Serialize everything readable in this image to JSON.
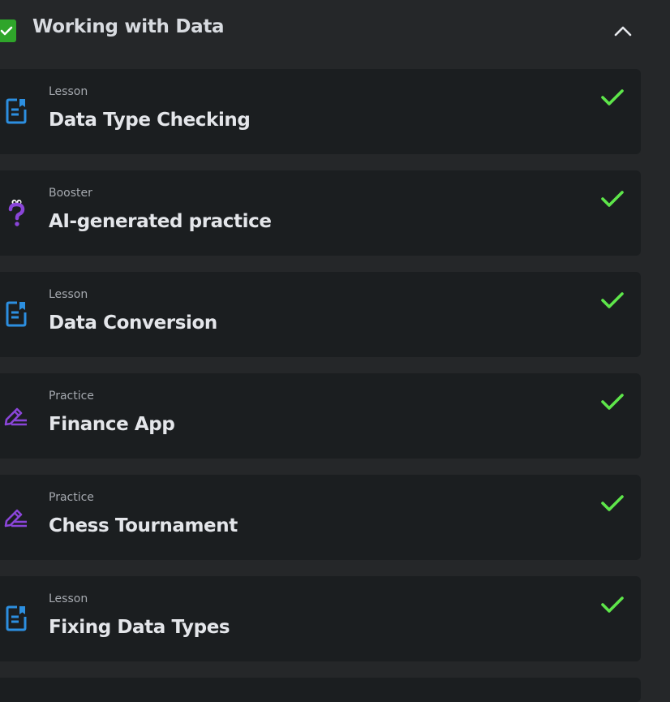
{
  "section": {
    "title": "Working with Data"
  },
  "colors": {
    "accent_green": "#2fa52a",
    "check_green": "#5ee64a",
    "lesson_blue": "#2c8fe0",
    "practice_purple": "#8a45d8"
  },
  "items": [
    {
      "kind": "Lesson",
      "title": "Data Type Checking",
      "icon": "lesson-document-icon",
      "completed": true
    },
    {
      "kind": "Booster",
      "title": "AI-generated practice",
      "icon": "booster-question-icon",
      "completed": true
    },
    {
      "kind": "Lesson",
      "title": "Data Conversion",
      "icon": "lesson-document-icon",
      "completed": true
    },
    {
      "kind": "Practice",
      "title": "Finance App",
      "icon": "practice-pencil-icon",
      "completed": true
    },
    {
      "kind": "Practice",
      "title": "Chess Tournament",
      "icon": "practice-pencil-icon",
      "completed": true
    },
    {
      "kind": "Lesson",
      "title": "Fixing Data Types",
      "icon": "lesson-document-icon",
      "completed": true
    }
  ]
}
